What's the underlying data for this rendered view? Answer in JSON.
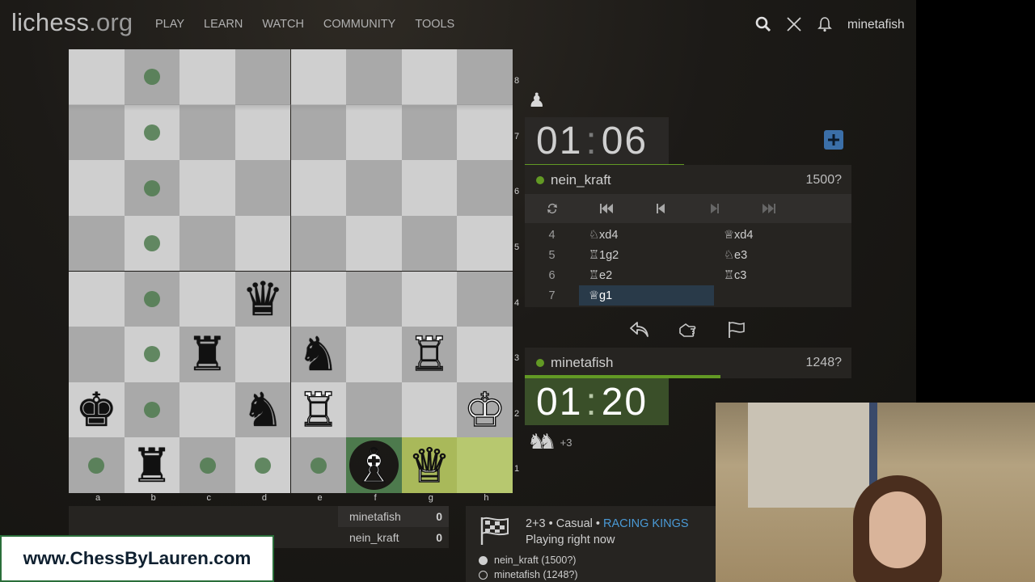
{
  "header": {
    "logo_main": "lichess",
    "logo_tld": ".org",
    "nav": [
      "PLAY",
      "LEARN",
      "WATCH",
      "COMMUNITY",
      "TOOLS"
    ],
    "username": "minetafish"
  },
  "board": {
    "rank_labels": [
      "8",
      "7",
      "6",
      "5",
      "4",
      "3",
      "2",
      "1"
    ],
    "file_labels": [
      "a",
      "b",
      "c",
      "d",
      "e",
      "f",
      "g",
      "h"
    ]
  },
  "opponent": {
    "clock_min": "01",
    "clock_sec": "06",
    "name": "nein_kraft",
    "rating": "1500?"
  },
  "player": {
    "clock_min": "01",
    "clock_sec": "20",
    "name": "minetafish",
    "rating": "1248?",
    "material_diff": "+3"
  },
  "moves": [
    {
      "num": "4",
      "white": "♘xd4",
      "black": "♕xd4"
    },
    {
      "num": "5",
      "white": "♖1g2",
      "black": "♘e3"
    },
    {
      "num": "6",
      "white": "♖e2",
      "black": "♖c3"
    },
    {
      "num": "7",
      "white": "♕g1",
      "black": ""
    }
  ],
  "scoreboard": [
    {
      "name": "minetafish",
      "score": "0"
    },
    {
      "name": "nein_kraft",
      "score": "0"
    }
  ],
  "game_info": {
    "clock_mode": "2+3 • Casual • ",
    "variant": "RACING KINGS",
    "status": "Playing right now",
    "white_player": "nein_kraft (1500?)",
    "black_player": "minetafish (1248?)"
  },
  "promo_text": "www.ChessByLauren.com",
  "colors": {
    "accent_green": "#629924",
    "highlight_move": "#a9b95a",
    "variant_link": "#4a9ad6"
  }
}
